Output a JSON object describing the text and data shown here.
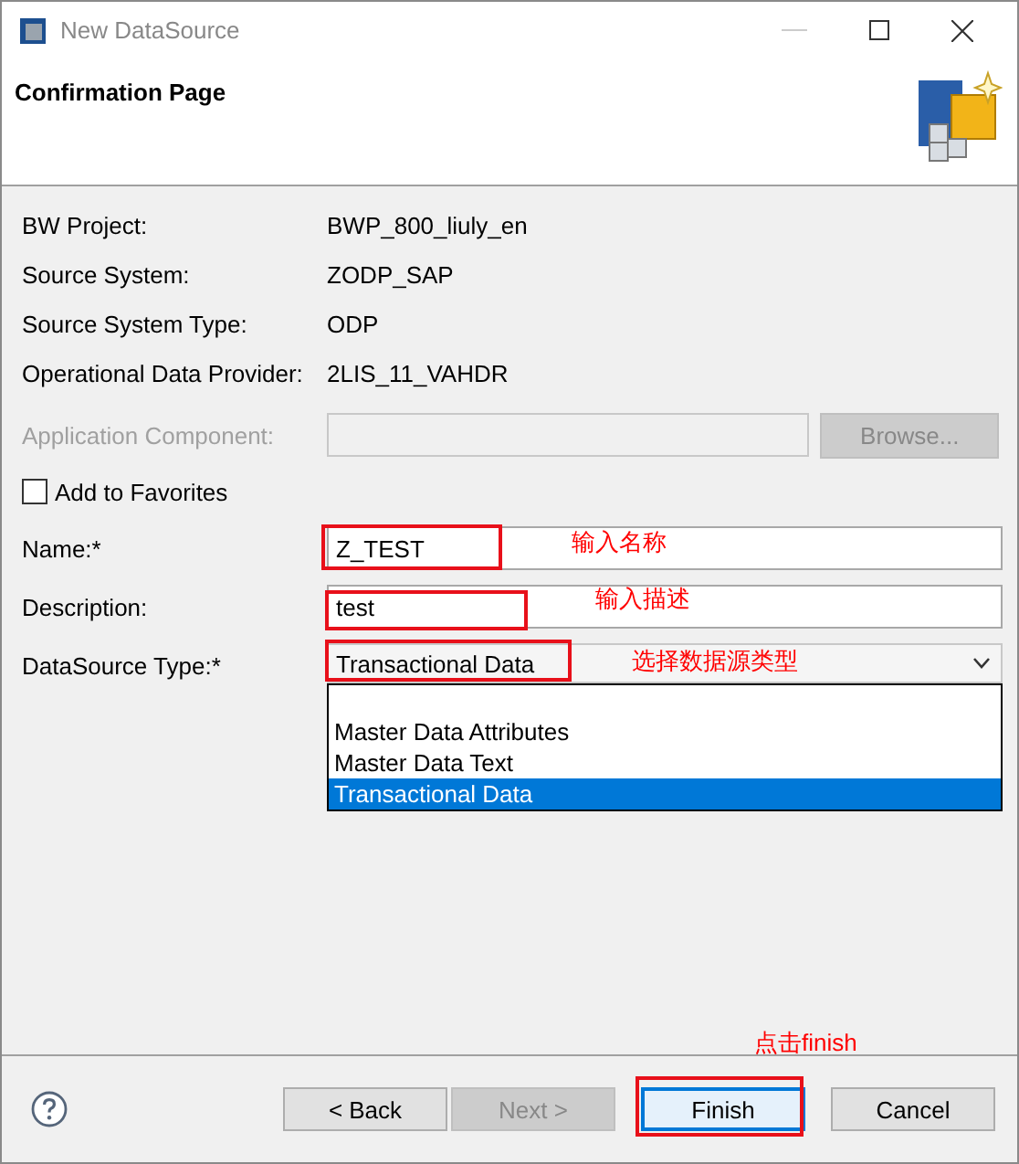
{
  "window": {
    "title": "New DataSource"
  },
  "header": {
    "title": "Confirmation Page"
  },
  "info": [
    {
      "label": "BW Project:",
      "value": "BWP_800_liuly_en"
    },
    {
      "label": "Source System:",
      "value": "ZODP_SAP"
    },
    {
      "label": "Source System Type:",
      "value": "ODP"
    },
    {
      "label": "Operational Data Provider:",
      "value": "2LIS_11_VAHDR"
    }
  ],
  "application_component": {
    "label": "Application Component:",
    "disabled": true,
    "button": "Browse..."
  },
  "favorites": {
    "label": "Add to Favorites",
    "checked": false
  },
  "name": {
    "label": "Name:*",
    "value": "Z_TEST",
    "note": "输入名称"
  },
  "description": {
    "label": "Description:",
    "value": "test",
    "note": "输入描述"
  },
  "datasource_type": {
    "label": "DataSource Type:*",
    "value": "Transactional Data",
    "note": "选择数据源类型",
    "expanded": true,
    "options": [
      {
        "label": "Master Data Attributes",
        "selected": false
      },
      {
        "label": "Master Data Text",
        "selected": false
      },
      {
        "label": "Transactional Data",
        "selected": true
      }
    ]
  },
  "finish_note": "点击finish",
  "buttons": [
    {
      "label": "< Back",
      "disabled": false,
      "highlighted": false
    },
    {
      "label": "Next >",
      "disabled": true,
      "highlighted": false
    },
    {
      "label": "Finish",
      "disabled": false,
      "highlighted": true
    },
    {
      "label": "Cancel",
      "disabled": false,
      "highlighted": false
    }
  ]
}
